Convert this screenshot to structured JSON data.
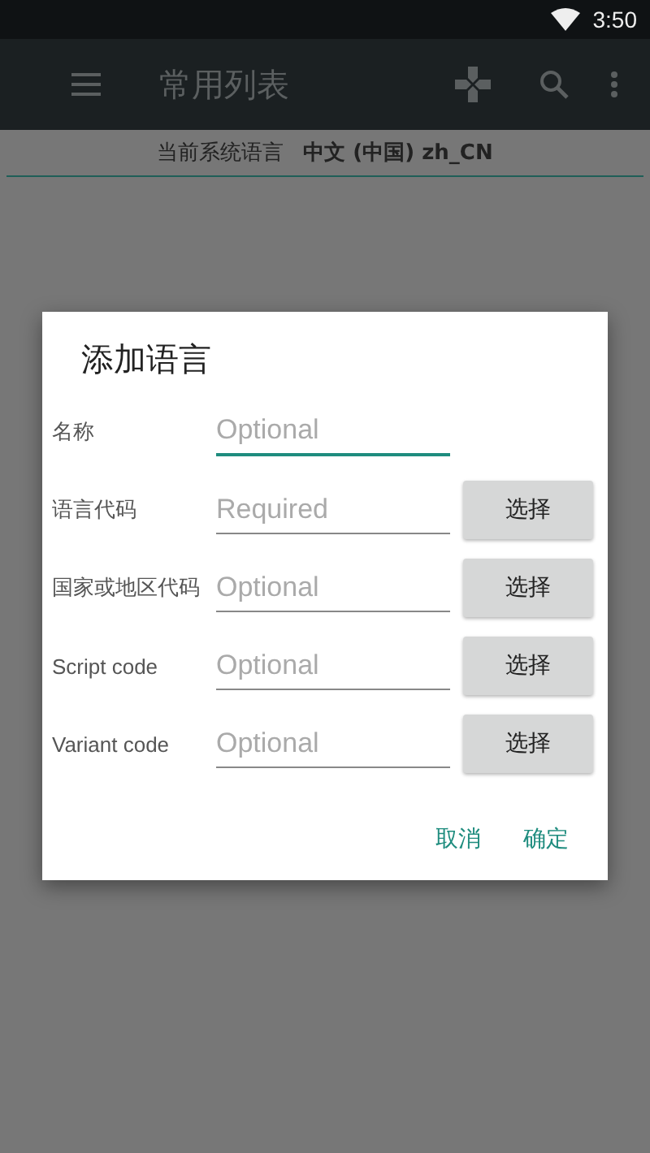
{
  "status_bar": {
    "time": "3:50"
  },
  "app_bar": {
    "title": "常用列表"
  },
  "banner": {
    "label": "当前系统语言",
    "value": "中文 (中国) zh_CN"
  },
  "dialog": {
    "title": "添加语言",
    "fields": [
      {
        "label": "名称",
        "placeholder": "Optional",
        "focused": true
      },
      {
        "label": "语言代码",
        "placeholder": "Required",
        "focused": false,
        "button": "选择"
      },
      {
        "label": "国家或地区代码",
        "placeholder": "Optional",
        "focused": false,
        "button": "选择"
      },
      {
        "label": "Script code",
        "placeholder": "Optional",
        "focused": false,
        "button": "选择"
      },
      {
        "label": "Variant code",
        "placeholder": "Optional",
        "focused": false,
        "button": "选择"
      }
    ],
    "actions": [
      "取消",
      "确定"
    ]
  }
}
